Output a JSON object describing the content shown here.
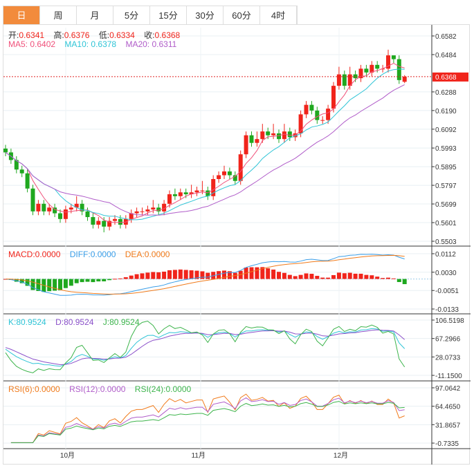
{
  "tabs": [
    {
      "label": "日",
      "active": true
    },
    {
      "label": "周"
    },
    {
      "label": "月"
    },
    {
      "label": "5分"
    },
    {
      "label": "15分"
    },
    {
      "label": "30分"
    },
    {
      "label": "60分"
    },
    {
      "label": "4时"
    }
  ],
  "ohlc_legend": {
    "open_label": "开:",
    "open": "0.6341",
    "high_label": "高:",
    "high": "0.6376",
    "low_label": "低:",
    "low": "0.6334",
    "close_label": "收:",
    "close": "0.6368"
  },
  "ma_legend": {
    "ma5": "MA5: 0.6402",
    "ma10": "MA10: 0.6378",
    "ma20": "MA20: 0.6311"
  },
  "macd_legend": {
    "macd": "MACD:0.0000",
    "diff": "DIFF:0.0000",
    "dea": "DEA:0.0000"
  },
  "kdj_legend": {
    "k": "K:80.9524",
    "d": "D:80.9524",
    "j": "J:80.9524"
  },
  "rsi_legend": {
    "rsi6": "RSI(6):0.0000",
    "rsi12": "RSI(12):0.0000",
    "rsi24": "RSI(24):0.0000"
  },
  "colors": {
    "up": "#f0241b",
    "down": "#1fa81f",
    "ma5": "#f0507a",
    "ma10": "#2ec4d6",
    "ma20": "#b05cc9",
    "accent": "#f28b3c"
  },
  "chart_data": {
    "type": "candlestick",
    "current_price": "0.6368",
    "price_axis": {
      "ticks": [
        "0.6582",
        "0.6484",
        "0.6288",
        "0.6190",
        "0.6092",
        "0.5993",
        "0.5895",
        "0.5797",
        "0.5699",
        "0.5601",
        "0.5503"
      ],
      "range": [
        0.5503,
        0.6582
      ]
    },
    "macd_axis": {
      "ticks": [
        "0.0112",
        "0.0030",
        "-0.0051",
        "-0.0133"
      ],
      "range": [
        -0.0133,
        0.0112
      ]
    },
    "kdj_axis": {
      "ticks": [
        "106.5198",
        "67.2966",
        "28.0733",
        "-11.1500"
      ],
      "range": [
        -11.15,
        106.5198
      ]
    },
    "rsi_axis": {
      "ticks": [
        "97.0642",
        "64.4650",
        "31.8657",
        "-0.7335"
      ],
      "range": [
        -0.7335,
        97.0642
      ]
    },
    "x_labels": [
      {
        "label": "10月",
        "index": 11
      },
      {
        "label": "11月",
        "index": 35
      },
      {
        "label": "12月",
        "index": 61
      }
    ],
    "open": [
      0.599,
      0.597,
      0.593,
      0.588,
      0.586,
      0.578,
      0.566,
      0.57,
      0.566,
      0.568,
      0.565,
      0.562,
      0.567,
      0.568,
      0.57,
      0.566,
      0.563,
      0.559,
      0.561,
      0.558,
      0.561,
      0.562,
      0.559,
      0.562,
      0.565,
      0.566,
      0.566,
      0.567,
      0.568,
      0.566,
      0.57,
      0.575,
      0.574,
      0.576,
      0.575,
      0.576,
      0.577,
      0.577,
      0.574,
      0.583,
      0.585,
      0.587,
      0.585,
      0.582,
      0.596,
      0.606,
      0.602,
      0.604,
      0.608,
      0.606,
      0.607,
      0.604,
      0.608,
      0.605,
      0.607,
      0.617,
      0.622,
      0.619,
      0.614,
      0.614,
      0.62,
      0.632,
      0.638,
      0.632,
      0.638,
      0.636,
      0.641,
      0.639,
      0.643,
      0.641,
      0.641,
      0.648,
      0.646,
      0.6341
    ],
    "high": [
      0.601,
      0.599,
      0.595,
      0.59,
      0.588,
      0.58,
      0.572,
      0.572,
      0.57,
      0.57,
      0.567,
      0.569,
      0.57,
      0.574,
      0.572,
      0.568,
      0.565,
      0.563,
      0.563,
      0.563,
      0.564,
      0.564,
      0.564,
      0.567,
      0.568,
      0.568,
      0.569,
      0.572,
      0.57,
      0.572,
      0.577,
      0.578,
      0.578,
      0.578,
      0.58,
      0.579,
      0.582,
      0.579,
      0.585,
      0.587,
      0.59,
      0.589,
      0.587,
      0.598,
      0.608,
      0.608,
      0.608,
      0.612,
      0.61,
      0.612,
      0.609,
      0.612,
      0.61,
      0.609,
      0.619,
      0.624,
      0.624,
      0.621,
      0.616,
      0.622,
      0.634,
      0.642,
      0.64,
      0.642,
      0.64,
      0.643,
      0.643,
      0.645,
      0.645,
      0.643,
      0.651,
      0.648,
      0.648,
      0.6376
    ],
    "low": [
      0.595,
      0.591,
      0.586,
      0.584,
      0.576,
      0.564,
      0.564,
      0.564,
      0.564,
      0.563,
      0.56,
      0.56,
      0.565,
      0.566,
      0.564,
      0.561,
      0.557,
      0.557,
      0.555,
      0.556,
      0.559,
      0.557,
      0.557,
      0.56,
      0.563,
      0.564,
      0.564,
      0.565,
      0.564,
      0.564,
      0.568,
      0.572,
      0.572,
      0.573,
      0.573,
      0.574,
      0.575,
      0.572,
      0.572,
      0.581,
      0.583,
      0.583,
      0.58,
      0.58,
      0.594,
      0.6,
      0.6,
      0.602,
      0.604,
      0.604,
      0.602,
      0.602,
      0.603,
      0.603,
      0.605,
      0.615,
      0.617,
      0.612,
      0.612,
      0.612,
      0.618,
      0.63,
      0.63,
      0.63,
      0.634,
      0.634,
      0.637,
      0.637,
      0.639,
      0.639,
      0.639,
      0.644,
      0.633,
      0.6334
    ],
    "close": [
      0.597,
      0.593,
      0.588,
      0.586,
      0.578,
      0.566,
      0.57,
      0.566,
      0.568,
      0.565,
      0.562,
      0.567,
      0.568,
      0.57,
      0.566,
      0.563,
      0.559,
      0.561,
      0.558,
      0.561,
      0.562,
      0.559,
      0.562,
      0.565,
      0.566,
      0.566,
      0.567,
      0.568,
      0.566,
      0.57,
      0.575,
      0.574,
      0.576,
      0.575,
      0.576,
      0.577,
      0.577,
      0.574,
      0.583,
      0.585,
      0.587,
      0.585,
      0.582,
      0.596,
      0.606,
      0.602,
      0.604,
      0.608,
      0.606,
      0.607,
      0.604,
      0.608,
      0.605,
      0.607,
      0.617,
      0.622,
      0.619,
      0.614,
      0.614,
      0.62,
      0.632,
      0.638,
      0.632,
      0.638,
      0.636,
      0.641,
      0.639,
      0.643,
      0.641,
      0.641,
      0.648,
      0.646,
      0.635,
      0.6368
    ]
  }
}
